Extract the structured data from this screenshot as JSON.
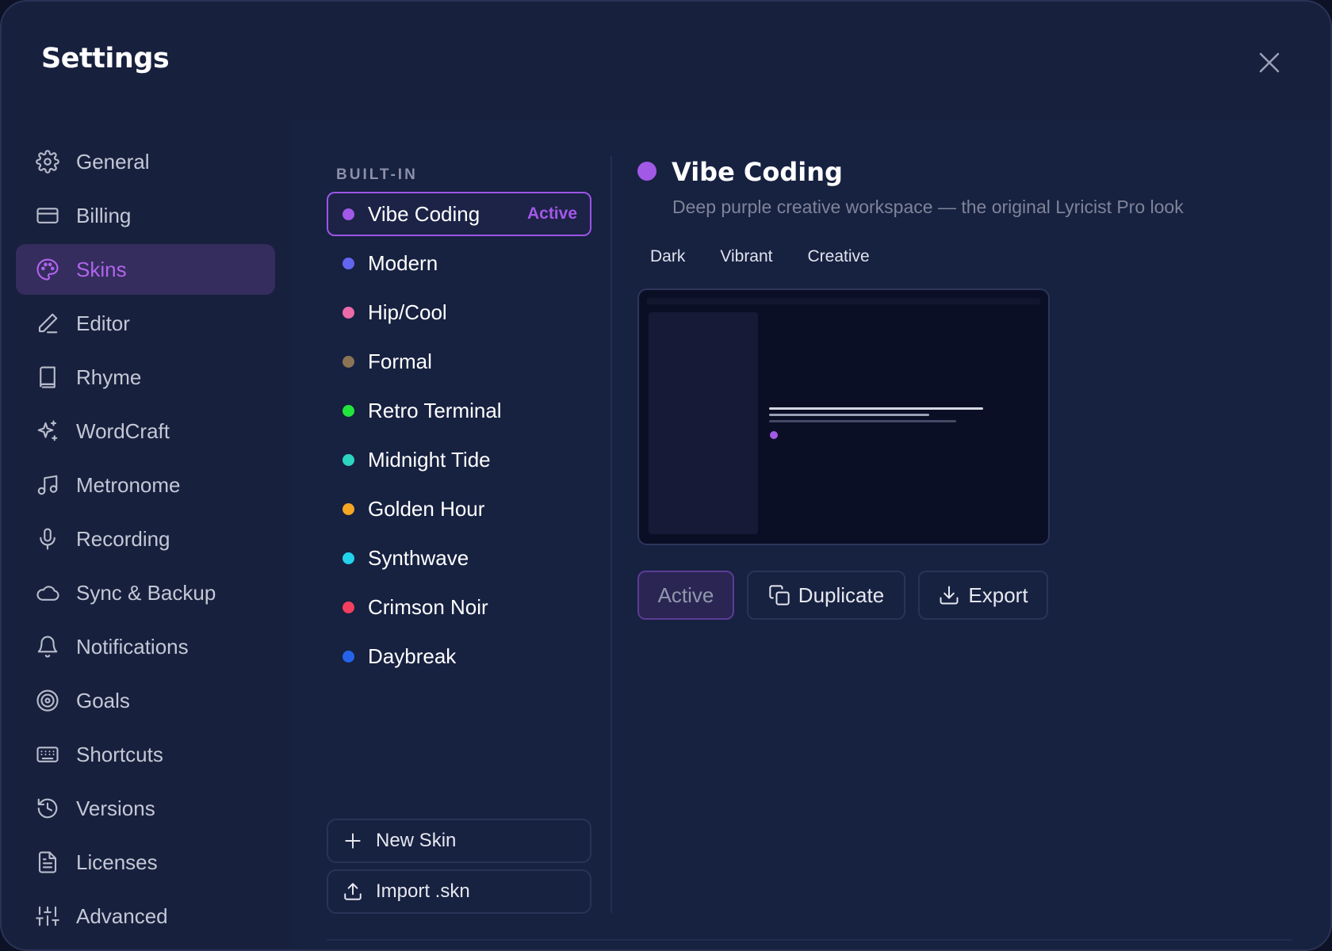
{
  "window": {
    "title": "Settings"
  },
  "sidebar": {
    "items": [
      {
        "label": "General",
        "icon": "gear-icon"
      },
      {
        "label": "Billing",
        "icon": "credit-card-icon"
      },
      {
        "label": "Skins",
        "icon": "palette-icon",
        "active": true
      },
      {
        "label": "Editor",
        "icon": "pencil-icon"
      },
      {
        "label": "Rhyme",
        "icon": "book-icon"
      },
      {
        "label": "WordCraft",
        "icon": "sparkles-icon"
      },
      {
        "label": "Metronome",
        "icon": "music-note-icon"
      },
      {
        "label": "Recording",
        "icon": "microphone-icon"
      },
      {
        "label": "Sync & Backup",
        "icon": "cloud-icon"
      },
      {
        "label": "Notifications",
        "icon": "bell-icon"
      },
      {
        "label": "Goals",
        "icon": "target-icon"
      },
      {
        "label": "Shortcuts",
        "icon": "keyboard-icon"
      },
      {
        "label": "Versions",
        "icon": "history-icon"
      },
      {
        "label": "Licenses",
        "icon": "document-icon"
      },
      {
        "label": "Advanced",
        "icon": "sliders-icon"
      }
    ]
  },
  "skins": {
    "section_label": "BUILT-IN",
    "active_badge": "Active",
    "items": [
      {
        "name": "Vibe Coding",
        "color": "#a259e6",
        "active": true
      },
      {
        "name": "Modern",
        "color": "#6366f1"
      },
      {
        "name": "Hip/Cool",
        "color": "#ec6aa8"
      },
      {
        "name": "Formal",
        "color": "#8b7355"
      },
      {
        "name": "Retro Terminal",
        "color": "#22e53c"
      },
      {
        "name": "Midnight Tide",
        "color": "#2dd4bf"
      },
      {
        "name": "Golden Hour",
        "color": "#f5a623"
      },
      {
        "name": "Synthwave",
        "color": "#22d3ee"
      },
      {
        "name": "Crimson Noir",
        "color": "#f43f5e"
      },
      {
        "name": "Daybreak",
        "color": "#2563eb"
      }
    ],
    "new_skin_label": "New Skin",
    "import_label": "Import .skn"
  },
  "detail": {
    "name": "Vibe Coding",
    "color": "#a259e6",
    "description": "Deep purple creative workspace — the original Lyricist Pro look",
    "tags": [
      "Dark",
      "Vibrant",
      "Creative"
    ],
    "actions": {
      "state_label": "Active",
      "duplicate_label": "Duplicate",
      "export_label": "Export"
    }
  }
}
